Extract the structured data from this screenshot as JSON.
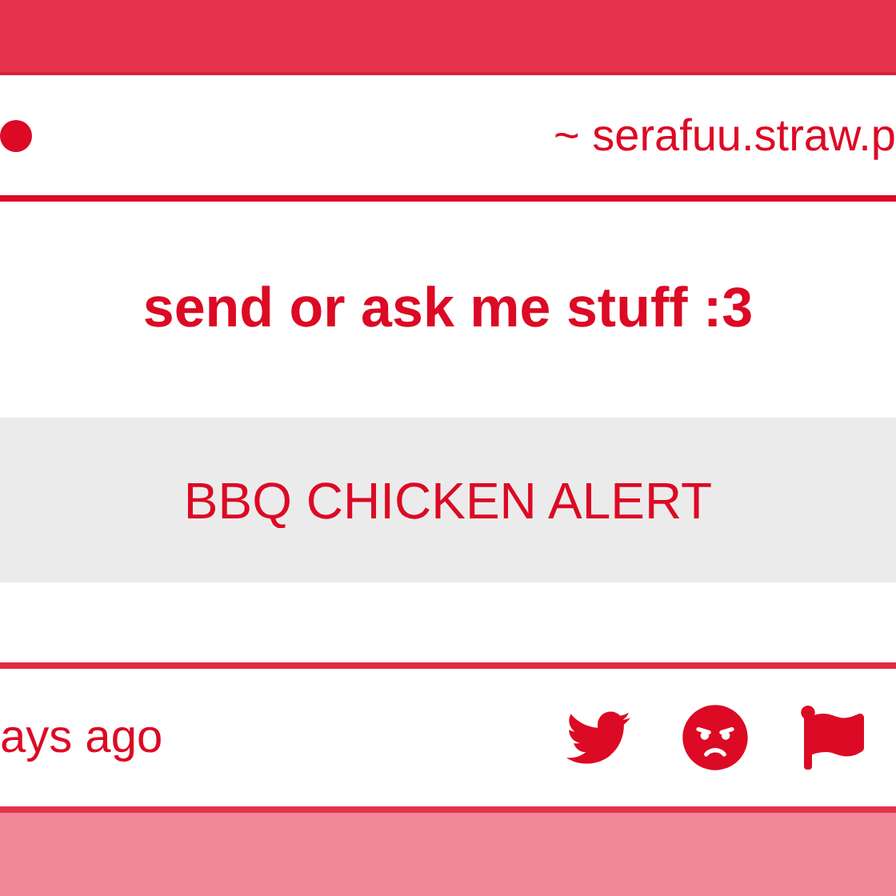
{
  "header": {
    "url": "~ serafuu.straw.p"
  },
  "question": {
    "title": "send or ask me stuff :3",
    "message": "BBQ CHICKEN ALERT"
  },
  "footer": {
    "time": "ays ago"
  }
}
